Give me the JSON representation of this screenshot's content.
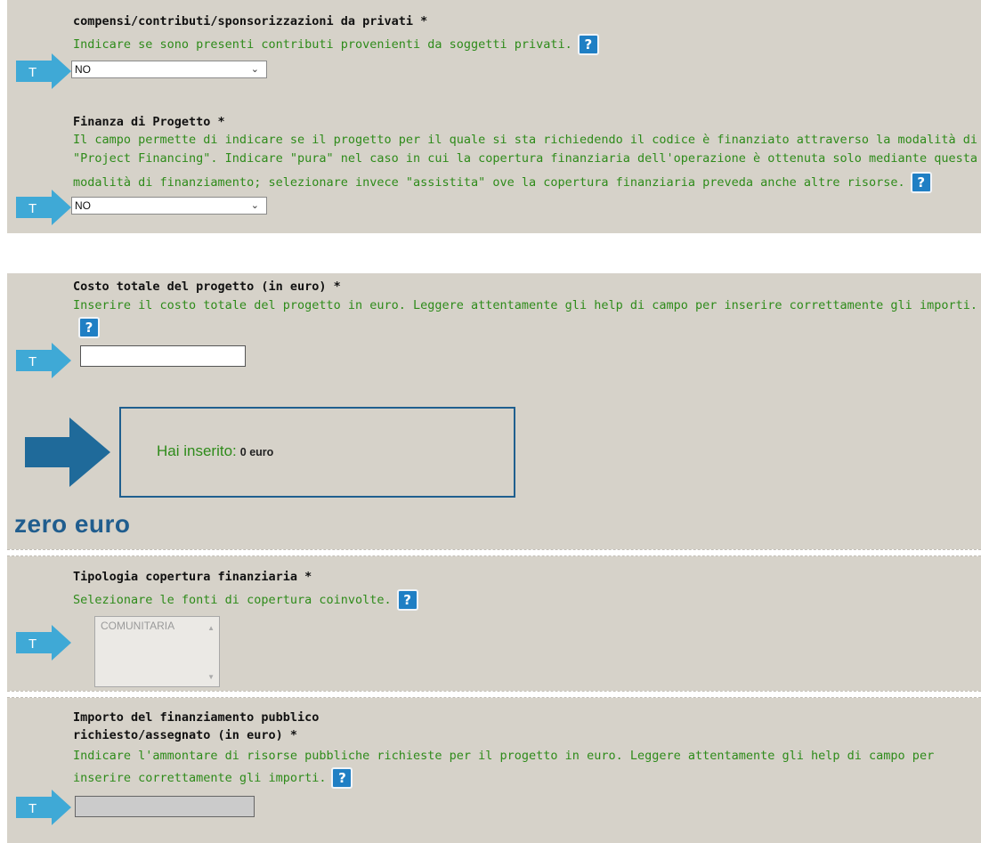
{
  "sections": {
    "privati": {
      "label": "compensi/contributi/sponsorizzazioni da privati *",
      "help": "Indicare se sono presenti contributi provenienti da soggetti privati.",
      "value": "NO"
    },
    "finanza": {
      "label": "Finanza di Progetto *",
      "help_lines": [
        "Il campo permette di indicare se il progetto per il quale si sta richiedendo il codice è finanziato attraverso la modalità di",
        "\"Project Financing\". Indicare \"pura\" nel caso in cui la copertura finanziaria dell'operazione è ottenuta solo mediante questa",
        "modalità di finanziamento; selezionare invece \"assistita\" ove la copertura finanziaria preveda anche altre risorse."
      ],
      "value": "NO"
    },
    "costo": {
      "label": "Costo totale del progetto (in euro) *",
      "help": "Inserire il costo totale del progetto in euro. Leggere attentamente gli help di campo per inserire correttamente gli importi.",
      "value": ""
    },
    "info": {
      "text": "Hai inserito:",
      "value": "0 euro",
      "caption": "zero euro"
    },
    "tipologia": {
      "label": "Tipologia copertura finanziaria *",
      "help": "Selezionare le fonti di copertura coinvolte.",
      "options": [
        "COMUNITARIA"
      ]
    },
    "importo": {
      "label_lines": [
        "Importo del finanziamento pubblico",
        "richiesto/assegnato (in euro) *"
      ],
      "help_lines": [
        "Indicare l'ammontare di risorse pubbliche richieste per il progetto in euro. Leggere attentamente gli help di campo per",
        "inserire correttamente gli importi."
      ],
      "value": ""
    }
  },
  "ui": {
    "help_glyph": "?",
    "t_glyph": "T",
    "chevron_glyph": "⌄",
    "scroll_up_glyph": "▲",
    "scroll_down_glyph": "▼"
  },
  "colors": {
    "panel": "#d6d2c9",
    "help_text": "#2e8b1a",
    "arrow": "#3fa9d6",
    "help_badge": "#1f7fc4",
    "big_arrow": "#1f6a9a",
    "zero_text": "#205d8e"
  }
}
